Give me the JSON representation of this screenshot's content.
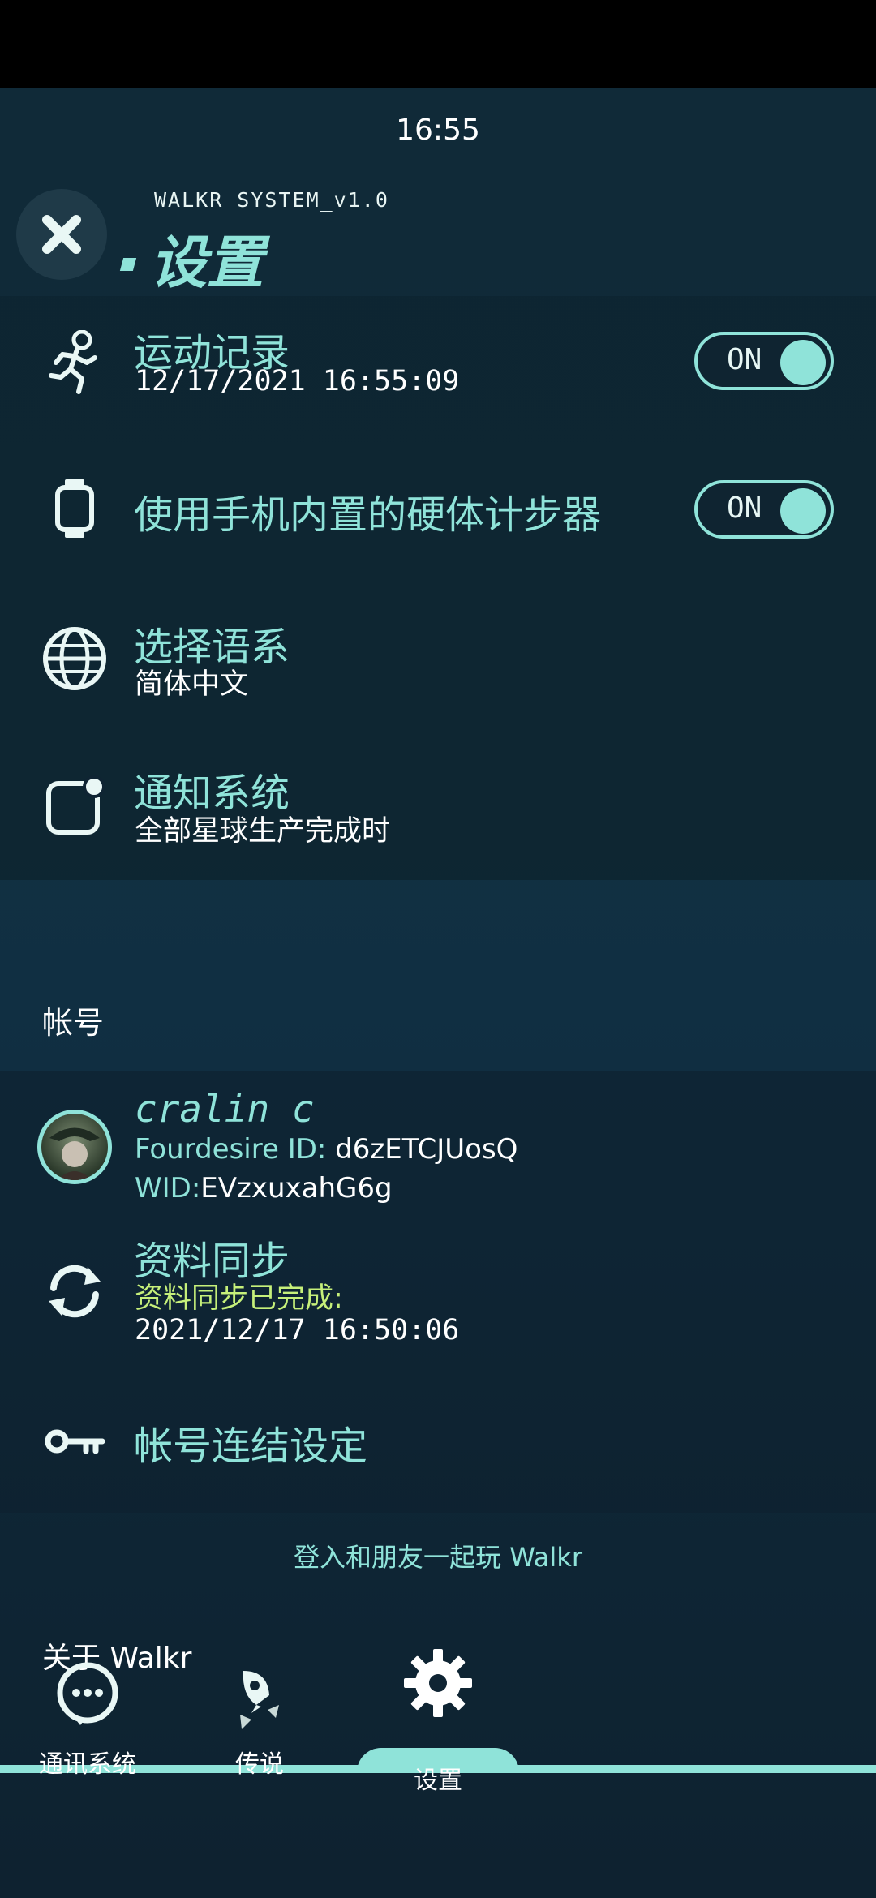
{
  "status_bar": {
    "time": "16:55"
  },
  "header": {
    "system_label": "WALKR SYSTEM_v1.0",
    "title": "设置"
  },
  "settings": {
    "exercise": {
      "label": "运动记录",
      "sub": "12/17/2021 16:55:09",
      "toggle": "ON"
    },
    "pedometer": {
      "label": "使用手机内置的硬体计步器",
      "toggle": "ON"
    },
    "language": {
      "label": "选择语系",
      "sub": "简体中文"
    },
    "notification": {
      "label": "通知系统",
      "sub": "全部星球生产完成时"
    }
  },
  "account": {
    "section_title": "帐号",
    "username": "cralin c",
    "fourdesire_key": "Fourdesire ID: ",
    "fourdesire_value": "d6zETCJUosQ",
    "wid_key": "WID:",
    "wid_value": "EVzxuxahG6g",
    "sync_label": "资料同步",
    "sync_status": "资料同步已完成:",
    "sync_time": "2021/12/17 16:50:06",
    "link_label": "帐号连结设定"
  },
  "invite_text": "登入和朋友一起玩 Walkr",
  "about_text": "关于 Walkr",
  "tabs": [
    {
      "label": "通讯系统",
      "icon": "chat-icon"
    },
    {
      "label": "传说",
      "icon": "rocket-icon"
    },
    {
      "label": "设置",
      "icon": "gear-icon"
    }
  ],
  "colors": {
    "accent": "#8fe3d9",
    "highlight": "#c6f07a",
    "background": "#0f2433"
  }
}
